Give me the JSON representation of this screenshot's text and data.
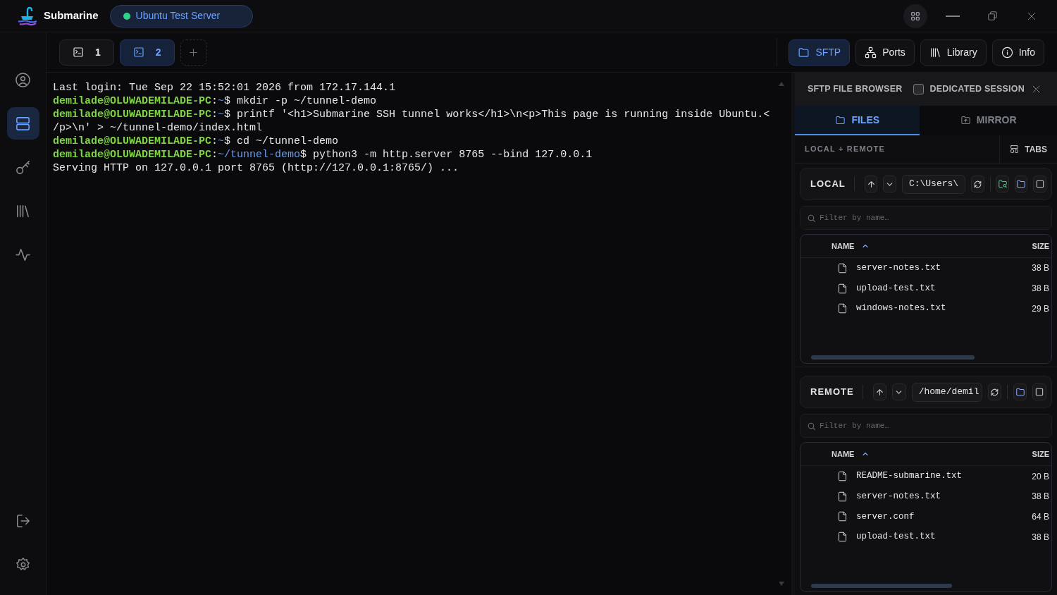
{
  "app": {
    "title": "Submarine"
  },
  "server": {
    "name": "Ubuntu Test Server",
    "connected": true
  },
  "sidebar": {
    "items": [
      {
        "selected": false
      },
      {
        "selected": true
      },
      {
        "selected": false
      },
      {
        "selected": false
      },
      {
        "selected": false
      }
    ]
  },
  "terminal_tabs": [
    {
      "label": "1",
      "selected": false
    },
    {
      "label": "2",
      "selected": true
    }
  ],
  "tool_buttons": [
    {
      "label": "SFTP",
      "selected": true
    },
    {
      "label": "Ports",
      "selected": false
    },
    {
      "label": "Library",
      "selected": false
    },
    {
      "label": "Info",
      "selected": false
    }
  ],
  "terminal": {
    "lines": [
      {
        "segments": [
          {
            "kind": "text",
            "text": "Last login: Tue Sep 22 15:52:01 2026 from 172.17.144.1"
          }
        ]
      },
      {
        "segments": [
          {
            "kind": "user",
            "text": "demilade@OLUWADEMILADE-PC"
          },
          {
            "kind": "text",
            "text": ":"
          },
          {
            "kind": "path",
            "text": "~"
          },
          {
            "kind": "text",
            "text": "$ mkdir -p ~/tunnel-demo"
          }
        ]
      },
      {
        "segments": [
          {
            "kind": "user",
            "text": "demilade@OLUWADEMILADE-PC"
          },
          {
            "kind": "text",
            "text": ":"
          },
          {
            "kind": "path",
            "text": "~"
          },
          {
            "kind": "text",
            "text": "$ printf '<h1>Submarine SSH tunnel works</h1>\\n<p>This page is running inside Ubuntu.</p>\\n' > ~/tunnel-demo/index.html"
          }
        ]
      },
      {
        "segments": [
          {
            "kind": "user",
            "text": "demilade@OLUWADEMILADE-PC"
          },
          {
            "kind": "text",
            "text": ":"
          },
          {
            "kind": "path",
            "text": "~"
          },
          {
            "kind": "text",
            "text": "$ cd ~/tunnel-demo"
          }
        ]
      },
      {
        "segments": [
          {
            "kind": "user",
            "text": "demilade@OLUWADEMILADE-PC"
          },
          {
            "kind": "text",
            "text": ":"
          },
          {
            "kind": "path",
            "text": "~/tunnel-demo"
          },
          {
            "kind": "text",
            "text": "$ python3 -m http.server 8765 --bind 127.0.0.1"
          }
        ]
      },
      {
        "segments": [
          {
            "kind": "text",
            "text": "Serving HTTP on 127.0.0.1 port 8765 (http://127.0.0.1:8765/) ..."
          }
        ]
      }
    ]
  },
  "sftp": {
    "title": "SFTP FILE BROWSER",
    "dedicated_session": {
      "label": "DEDICATED SESSION",
      "checked": false
    },
    "tabs": [
      {
        "label": "FILES",
        "selected": true
      },
      {
        "label": "MIRROR",
        "selected": false
      }
    ],
    "mode_label": "LOCAL + REMOTE",
    "layout_button": "TABS",
    "panes": [
      {
        "kind": "local",
        "title": "LOCAL",
        "path": "C:\\Users\\",
        "filter_placeholder": "Filter by name…",
        "columns": [
          "NAME",
          "SIZE"
        ],
        "files": [
          {
            "name": "server-notes.txt",
            "size": "38 B"
          },
          {
            "name": "upload-test.txt",
            "size": "38 B"
          },
          {
            "name": "windows-notes.txt",
            "size": "29 B"
          }
        ]
      },
      {
        "kind": "remote",
        "title": "REMOTE",
        "path": "/home/demil",
        "filter_placeholder": "Filter by name…",
        "columns": [
          "NAME",
          "SIZE"
        ],
        "files": [
          {
            "name": "README-submarine.txt",
            "size": "20 B"
          },
          {
            "name": "server-notes.txt",
            "size": "38 B"
          },
          {
            "name": "server.conf",
            "size": "64 B"
          },
          {
            "name": "upload-test.txt",
            "size": "38 B"
          }
        ]
      }
    ]
  }
}
